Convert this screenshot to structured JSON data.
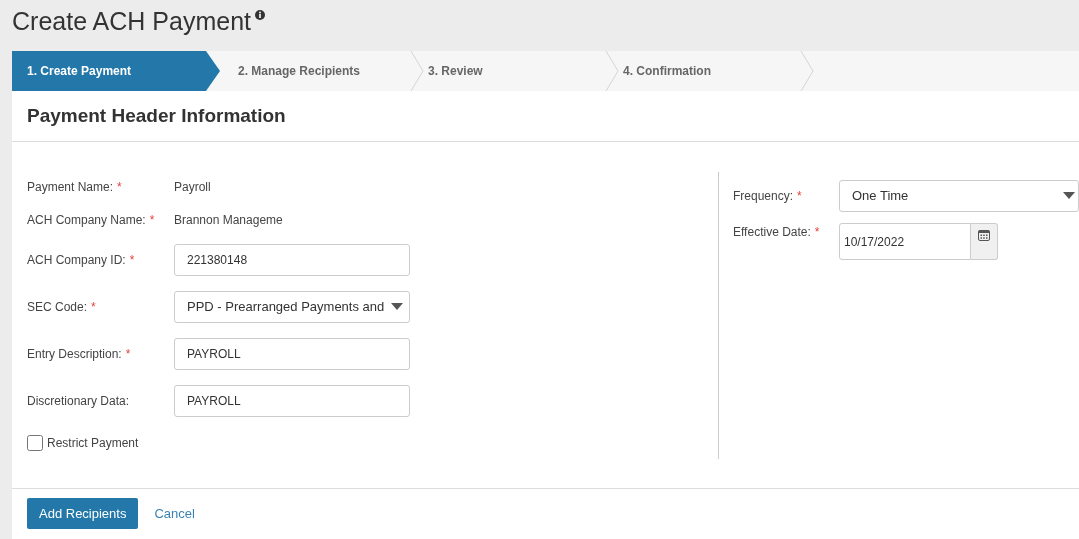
{
  "page": {
    "title": "Create ACH Payment"
  },
  "steps": [
    {
      "label": "1. Create Payment",
      "selected": true
    },
    {
      "label": "2. Manage Recipients",
      "selected": false
    },
    {
      "label": "3. Review",
      "selected": false
    },
    {
      "label": "4. Confirmation",
      "selected": false
    }
  ],
  "section": {
    "title": "Payment Header Information"
  },
  "left_fields": [
    {
      "kind": "text",
      "label": "Payment Name:",
      "mark": "*",
      "value": "Payroll"
    },
    {
      "kind": "text",
      "label": "ACH Company Name:",
      "mark": "*",
      "value": "Brannon Manageme"
    },
    {
      "kind": "input",
      "label": "ACH Company ID:",
      "mark": "*",
      "value": "221380148"
    },
    {
      "kind": "select",
      "label": "SEC Code:",
      "mark": "*",
      "value": "PPD - Prearranged Payments and"
    },
    {
      "kind": "input",
      "label": "Entry Description:",
      "mark": "*",
      "value": "PAYROLL"
    },
    {
      "kind": "input",
      "label": "Discretionary Data:",
      "value": "PAYROLL"
    }
  ],
  "restrict_payment": {
    "label": "Restrict Payment",
    "checked": false
  },
  "right_fields": [
    {
      "kind": "select",
      "label": "Frequency:",
      "mark": "*",
      "value": "One Time"
    },
    {
      "kind": "date",
      "label": "Effective Date:",
      "mark": "*",
      "value": "10/17/2022"
    }
  ],
  "buttons": {
    "primary": "Add Recipients",
    "cancel": "Cancel"
  }
}
